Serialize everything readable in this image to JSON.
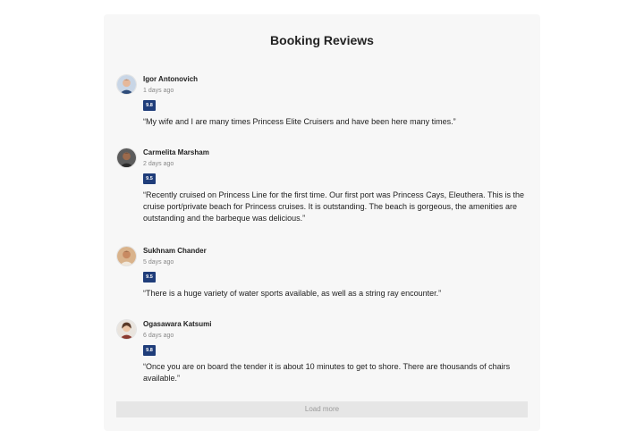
{
  "title": "Booking Reviews",
  "reviews": [
    {
      "name": "Igor Antonovich",
      "date": "1 days ago",
      "score": "9.8",
      "text": "“My wife and I are many times Princess Elite Cruisers and have been here many times.”",
      "avatar_bg": "#c9d6e6",
      "avatar_skin": "#e6b89a",
      "avatar_hair": "#3b2a20",
      "avatar_shirt": "#2e4c7a"
    },
    {
      "name": "Carmelita Marsham",
      "date": "2 days ago",
      "score": "9.5",
      "text": "“Recently cruised on Princess Line for the first time. Our first port was Princess Cays, Eleuthera. This is the cruise port/private beach for Princess cruises. It is outstanding. The beach is gorgeous, the amenities are outstanding and the barbeque was delicious.”",
      "avatar_bg": "#5c5c5c",
      "avatar_skin": "#9b6a4c",
      "avatar_hair": "#1e1a17",
      "avatar_shirt": "#2b2b2b"
    },
    {
      "name": "Sukhnam Chander",
      "date": "5 days ago",
      "score": "9.5",
      "text": "“There is a huge variety of water sports available, as well as a string ray encounter.”",
      "avatar_bg": "#d9b38c",
      "avatar_skin": "#c88a62",
      "avatar_hair": "#3a2a1f",
      "avatar_shirt": "#f0e8dc"
    },
    {
      "name": "Ogasawara Katsumi",
      "date": "6 days ago",
      "score": "9.8",
      "text": "“Once you are on board the tender it is about 10 minutes to get to shore. There are thousands of chairs available.”",
      "avatar_bg": "#e9e4de",
      "avatar_skin": "#edc7a8",
      "avatar_hair": "#5a3a28",
      "avatar_shirt": "#8a3a30"
    }
  ],
  "load_more_label": "Load more",
  "colors": {
    "panel_bg": "#f7f7f7",
    "score_badge": "#1f3d7a",
    "load_more_bg": "#e6e6e6"
  }
}
